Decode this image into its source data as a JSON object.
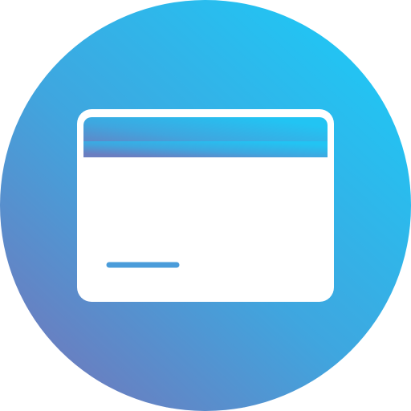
{
  "icon": {
    "name": "credit-card-icon",
    "colors": {
      "gradient_start": "#22C4F3",
      "gradient_mid": "#3FA6DF",
      "gradient_end": "#6A7EC0",
      "card_fill": "#FFFFFF",
      "card_stripe": "#FFFFFF",
      "signature_line": "#4A9CDA"
    }
  }
}
